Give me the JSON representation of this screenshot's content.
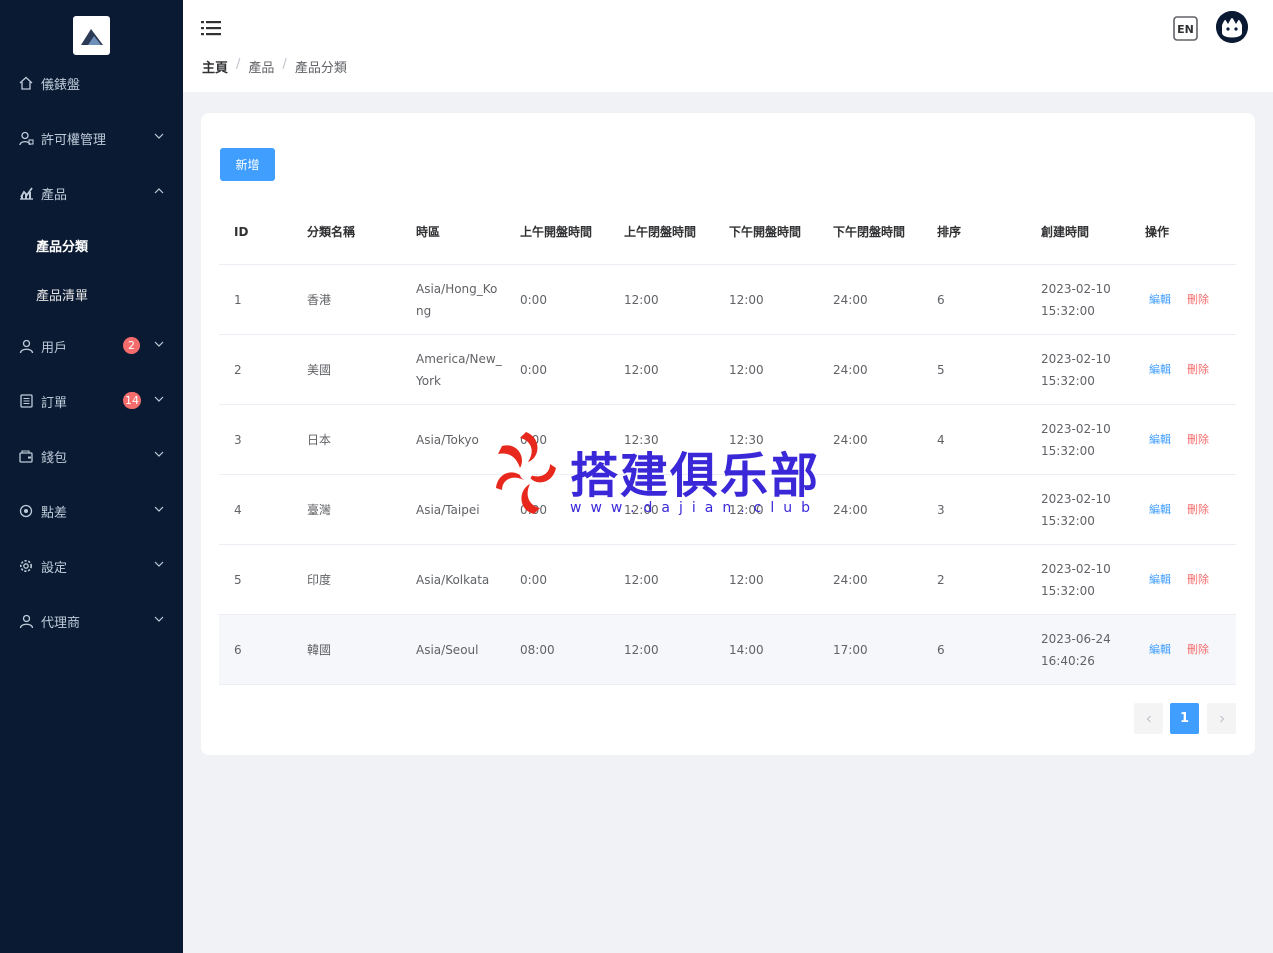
{
  "sidebar": {
    "items": [
      {
        "label": "儀錶盤",
        "icon": "home-icon"
      },
      {
        "label": "許可權管理",
        "icon": "user-lock-icon"
      },
      {
        "label": "產品",
        "icon": "chart-icon"
      },
      {
        "label": "產品分類",
        "sub": true
      },
      {
        "label": "產品清單",
        "sub": true
      },
      {
        "label": "用戶",
        "icon": "user-icon",
        "badge": "2"
      },
      {
        "label": "訂單",
        "icon": "document-icon",
        "badge": "14"
      },
      {
        "label": "錢包",
        "icon": "wallet-icon"
      },
      {
        "label": "點差",
        "icon": "target-icon"
      },
      {
        "label": "設定",
        "icon": "gear-icon"
      },
      {
        "label": "代理商",
        "icon": "agent-icon"
      }
    ]
  },
  "header": {
    "breadcrumb": [
      "主頁",
      "產品",
      "產品分類"
    ],
    "lang_label": "EN"
  },
  "toolbar": {
    "add_label": "新增"
  },
  "table": {
    "columns": [
      "ID",
      "分類名稱",
      "時區",
      "上午開盤時間",
      "上午閉盤時間",
      "下午開盤時間",
      "下午閉盤時間",
      "排序",
      "創建時間",
      "操作"
    ],
    "rows": [
      {
        "id": "1",
        "name": "香港",
        "tz": "Asia/Hong_Kong",
        "am_open": "0:00",
        "am_close": "12:00",
        "pm_open": "12:00",
        "pm_close": "24:00",
        "sort": "6",
        "created_date": "2023-02-10",
        "created_time": "15:32:00"
      },
      {
        "id": "2",
        "name": "美國",
        "tz": "America/New_York",
        "am_open": "0:00",
        "am_close": "12:00",
        "pm_open": "12:00",
        "pm_close": "24:00",
        "sort": "5",
        "created_date": "2023-02-10",
        "created_time": "15:32:00"
      },
      {
        "id": "3",
        "name": "日本",
        "tz": "Asia/Tokyo",
        "am_open": "0:00",
        "am_close": "12:30",
        "pm_open": "12:30",
        "pm_close": "24:00",
        "sort": "4",
        "created_date": "2023-02-10",
        "created_time": "15:32:00"
      },
      {
        "id": "4",
        "name": "臺灣",
        "tz": "Asia/Taipei",
        "am_open": "0:00",
        "am_close": "12:00",
        "pm_open": "12:00",
        "pm_close": "24:00",
        "sort": "3",
        "created_date": "2023-02-10",
        "created_time": "15:32:00"
      },
      {
        "id": "5",
        "name": "印度",
        "tz": "Asia/Kolkata",
        "am_open": "0:00",
        "am_close": "12:00",
        "pm_open": "12:00",
        "pm_close": "24:00",
        "sort": "2",
        "created_date": "2023-02-10",
        "created_time": "15:32:00"
      },
      {
        "id": "6",
        "name": "韓國",
        "tz": "Asia/Seoul",
        "am_open": "08:00",
        "am_close": "12:00",
        "pm_open": "14:00",
        "pm_close": "17:00",
        "sort": "6",
        "created_date": "2023-06-24",
        "created_time": "16:40:26"
      }
    ],
    "edit_label": "編輯",
    "delete_label": "刪除"
  },
  "pagination": {
    "current": "1",
    "prev_icon": "chevron-left-icon",
    "next_icon": "chevron-right-icon"
  },
  "watermark": {
    "text": "搭建俱乐部",
    "url": "www.dajian.club"
  },
  "colors": {
    "sidebar_bg": "#0a1a33",
    "primary": "#409eff",
    "danger": "#f56c6c",
    "watermark": "#3a28d8"
  }
}
